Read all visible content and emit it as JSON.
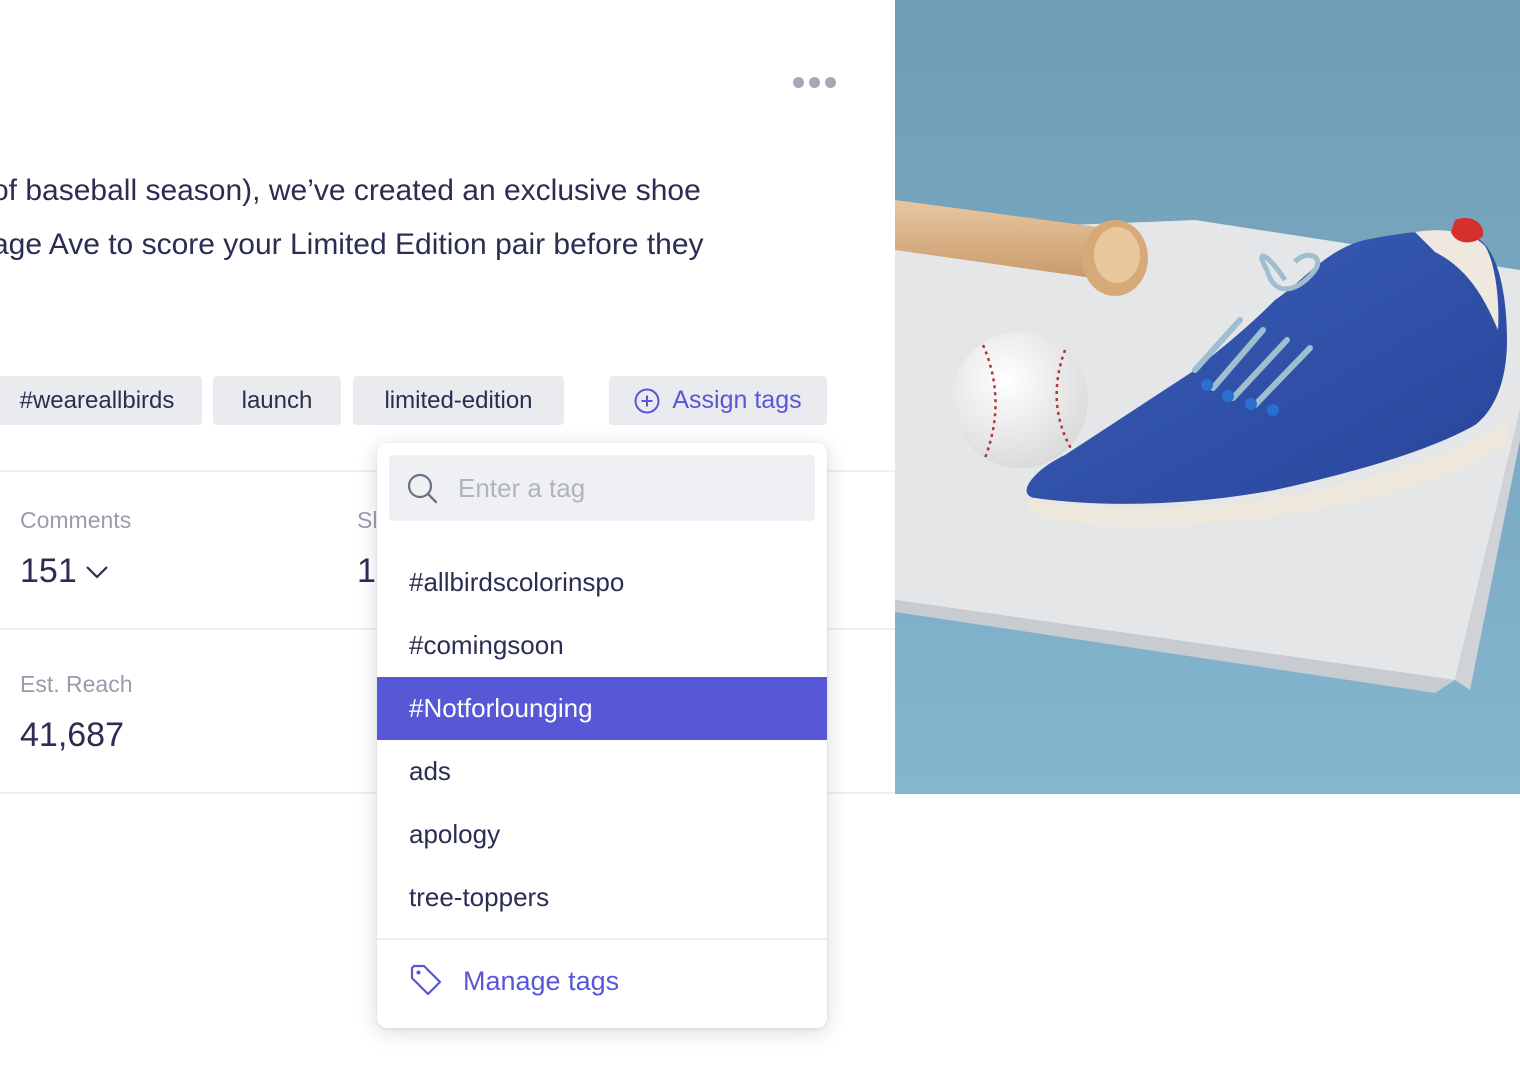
{
  "post": {
    "caption_lines": [
      "of baseball season), we’ve created an exclusive shoe",
      "age Ave to score your Limited Edition pair before they"
    ],
    "tags": [
      "#weareallbirds",
      "launch",
      "limited-edition"
    ],
    "assign_tags_label": "Assign tags"
  },
  "stats": {
    "comments_label": "Comments",
    "comments_value": "151",
    "shares_label_partial": "Sl",
    "shares_value_partial": "1",
    "reach_label": "Est. Reach",
    "reach_value": "41,687"
  },
  "tag_dropdown": {
    "search_placeholder": "Enter a tag",
    "options": [
      "#allbirdscolorinspo",
      "#comingsoon",
      "#Notforlounging",
      "ads",
      "apology",
      "tree-toppers"
    ],
    "highlighted_option": "#Notforlounging",
    "manage_label": "Manage tags"
  },
  "icons": {
    "more": "more-horizontal-icon",
    "assign": "plus-circle-icon",
    "comments_toggle": "chevron-down-icon",
    "search": "search-icon",
    "manage": "tag-icon"
  },
  "colors": {
    "accent": "#5757d8",
    "highlight": "#5858d6",
    "chip_bg": "#e9ebef",
    "text": "#2b2d52",
    "muted": "#9a9cab",
    "photo_bg": "#7aaec6"
  }
}
